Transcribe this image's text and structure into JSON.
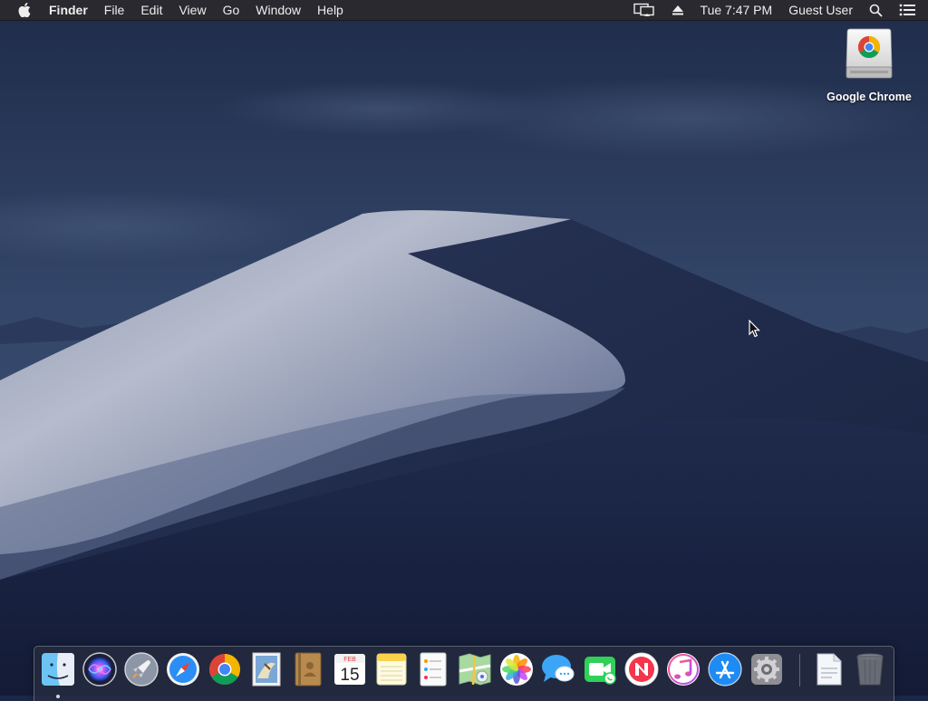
{
  "menubar": {
    "app_name": "Finder",
    "menus": [
      "File",
      "Edit",
      "View",
      "Go",
      "Window",
      "Help"
    ],
    "clock": "Tue 7:47 PM",
    "user": "Guest User"
  },
  "desktop": {
    "icons": [
      {
        "label": "Google Chrome",
        "icon": "chrome-installer-disk-icon"
      }
    ]
  },
  "dock": {
    "apps": [
      "finder",
      "siri",
      "launchpad",
      "safari",
      "chrome",
      "mail",
      "contacts",
      "calendar",
      "notes",
      "reminders",
      "maps",
      "photos",
      "messages",
      "facetime",
      "news",
      "itunes",
      "app-store",
      "system-preferences"
    ],
    "calendar": {
      "month": "FEB",
      "day": "15"
    },
    "running": [
      "finder"
    ],
    "right_items": [
      "document",
      "trash"
    ]
  },
  "colors": {
    "menubar_bg": "#2a2a2e",
    "menubar_text": "#eeeeee",
    "wallpaper_sky": "#1b2748",
    "dune_light": "#a8afc4",
    "dune_shadow": "#1c2645"
  }
}
